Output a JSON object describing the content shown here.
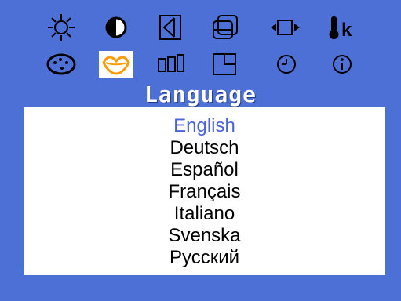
{
  "menu": {
    "title": "Language",
    "icons": [
      {
        "name": "brightness-icon",
        "selected": false
      },
      {
        "name": "contrast-icon",
        "selected": false
      },
      {
        "name": "horizontal-position-icon",
        "selected": false
      },
      {
        "name": "vertical-position-icon",
        "selected": false
      },
      {
        "name": "horizontal-size-icon",
        "selected": false
      },
      {
        "name": "color-temperature-icon",
        "selected": false
      },
      {
        "name": "color-palette-icon",
        "selected": false
      },
      {
        "name": "language-lips-icon",
        "selected": true
      },
      {
        "name": "pincushion-icon",
        "selected": false
      },
      {
        "name": "osd-position-icon",
        "selected": false
      },
      {
        "name": "osd-timer-icon",
        "selected": false
      },
      {
        "name": "information-icon",
        "selected": false
      }
    ],
    "icon_label": "k"
  },
  "languages": [
    "English",
    "Deutsch",
    "Español",
    "Français",
    "Italiano",
    "Svenska",
    "Русский"
  ],
  "selected_language": "English",
  "colors": {
    "background": "#4d70d6",
    "panel": "#ffffff",
    "selected_text": "#4a63d9",
    "default_text": "#000000",
    "selected_icon": "#ff9b00"
  }
}
